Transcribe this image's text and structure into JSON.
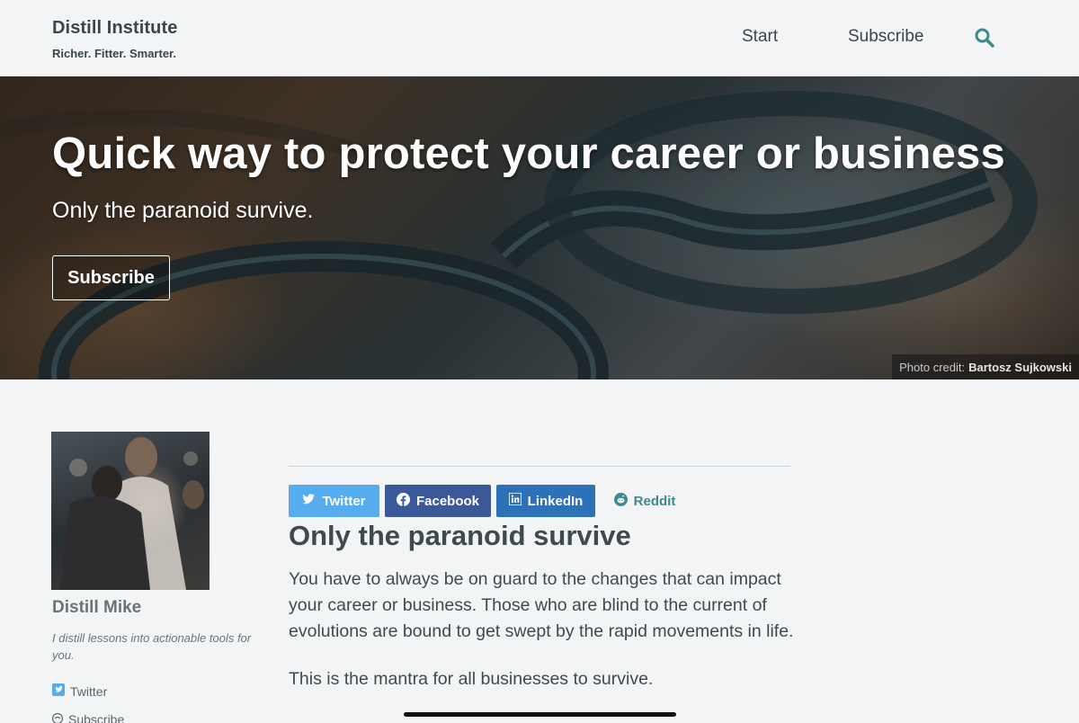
{
  "header": {
    "brand_title": "Distill Institute",
    "tagline": "Richer. Fitter. Smarter.",
    "nav": {
      "start": "Start",
      "subscribe": "Subscribe"
    },
    "search_icon": "search-icon",
    "accent_color": "#3d8a8c"
  },
  "hero": {
    "title": "Quick way to protect your career or business",
    "subtitle": "Only the paranoid survive.",
    "button": "Subscribe",
    "credit_prefix": "Photo credit:",
    "credit_name": "Bartosz Sujkowski"
  },
  "sidebar": {
    "author_name": "Distill Mike",
    "bio": "I distill lessons into actionable tools for you.",
    "links": {
      "twitter": "Twitter",
      "subscribe": "Subscribe"
    }
  },
  "article": {
    "share": {
      "twitter": "Twitter",
      "facebook": "Facebook",
      "linkedin": "LinkedIn",
      "reddit": "Reddit"
    },
    "share_colors": {
      "twitter": "#55acee",
      "facebook": "#3b5998",
      "linkedin": "#2d72b8"
    },
    "title": "Only the paranoid survive",
    "paragraphs": [
      "You have to always be on guard to the changes that can impact your career or business. Those who are blind to the current of evolutions are bound to get swept by the rapid movements in life.",
      "This is the mantra for all businesses to survive."
    ]
  }
}
